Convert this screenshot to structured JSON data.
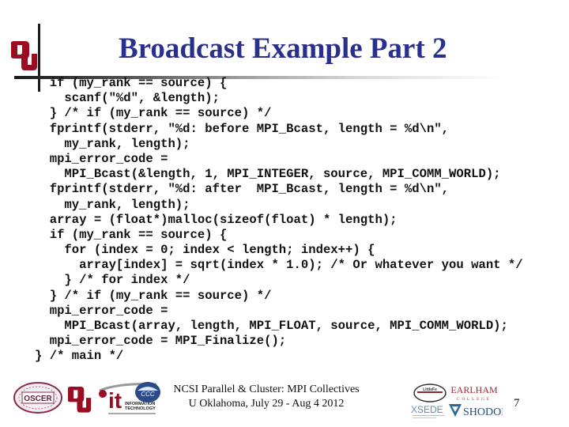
{
  "slide": {
    "title": "Broadcast Example Part 2",
    "title_color": "#2b2f8c",
    "accent_red": "#9b0c22",
    "code_lines": [
      "  if (my_rank == source) {",
      "    scanf(\"%d\", &length);",
      "  } /* if (my_rank == source) */",
      "  fprintf(stderr, \"%d: before MPI_Bcast, length = %d\\n\",",
      "    my_rank, length);",
      "  mpi_error_code =",
      "    MPI_Bcast(&length, 1, MPI_INTEGER, source, MPI_COMM_WORLD);",
      "  fprintf(stderr, \"%d: after  MPI_Bcast, length = %d\\n\",",
      "    my_rank, length);",
      "  array = (float*)malloc(sizeof(float) * length);",
      "  if (my_rank == source) {",
      "    for (index = 0; index < length; index++) {",
      "      array[index] = sqrt(index * 1.0); /* Or whatever you want */",
      "    } /* for index */",
      "  } /* if (my_rank == source) */",
      "  mpi_error_code =",
      "    MPI_Bcast(array, length, MPI_FLOAT, source, MPI_COMM_WORLD);",
      "  mpi_error_code = MPI_Finalize();",
      "} /* main */"
    ]
  },
  "footer": {
    "line1": "NCSI Parallel & Cluster: MPI Collectives",
    "line2": "U Oklahoma, July 29 - Aug 4 2012",
    "page_number": "7",
    "logos": {
      "oscer": "OSCER",
      "ou": "OU",
      "it": "it",
      "it_sub1": "INFORMATION",
      "it_sub2": "TECHNOLOGY",
      "ccc": "CCC",
      "littlefe": "LittleFe",
      "earlham": "EARLHAM",
      "earlham_sub": "COLLEGE",
      "xsede": "XSEDE",
      "shodor": "SHODOR"
    }
  }
}
